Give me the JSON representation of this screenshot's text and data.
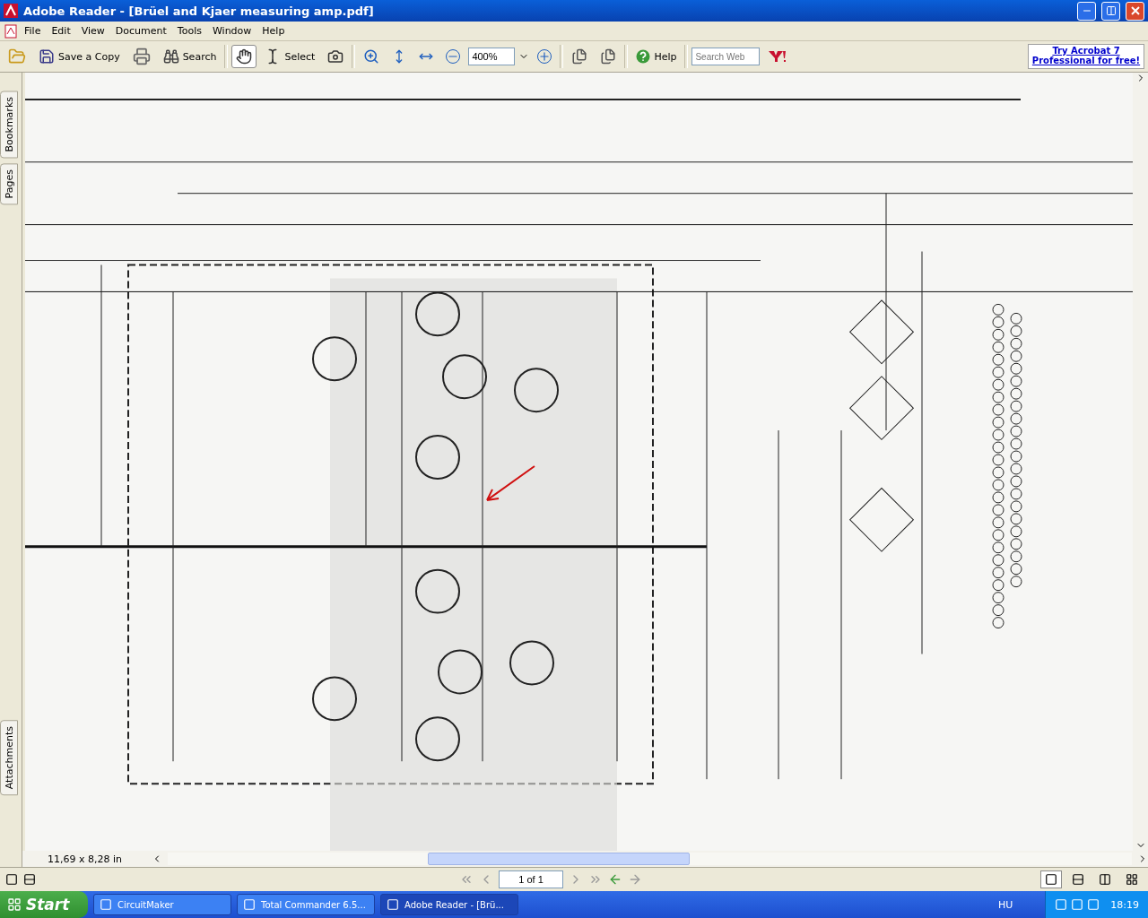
{
  "window": {
    "title": "Adobe Reader - [Brüel and Kjaer measuring amp.pdf]"
  },
  "menu": [
    "File",
    "Edit",
    "View",
    "Document",
    "Tools",
    "Window",
    "Help"
  ],
  "toolbar": [
    {
      "kind": "open",
      "selected": false
    },
    {
      "kind": "save",
      "label": "Save a Copy",
      "selected": false
    },
    {
      "kind": "print",
      "selected": false
    },
    {
      "kind": "search",
      "label": "Search",
      "selected": false
    },
    {
      "kind": "sep"
    },
    {
      "kind": "hand",
      "selected": true
    },
    {
      "kind": "select",
      "label": "Select",
      "selected": false
    },
    {
      "kind": "snapshot",
      "selected": false
    },
    {
      "kind": "sep"
    },
    {
      "kind": "zoomin",
      "selected": false
    },
    {
      "kind": "fitpage",
      "selected": false
    },
    {
      "kind": "fitwidth",
      "selected": false
    },
    {
      "kind": "zoomout",
      "selected": false
    },
    {
      "kind": "zoomfield",
      "label": "400%"
    },
    {
      "kind": "zoomplus",
      "selected": false
    },
    {
      "kind": "sep"
    },
    {
      "kind": "pages",
      "selected": false
    },
    {
      "kind": "rotate",
      "selected": false
    },
    {
      "kind": "sep"
    },
    {
      "kind": "help",
      "label": "Help",
      "selected": false
    },
    {
      "kind": "sep"
    },
    {
      "kind": "websearch",
      "placeholder": "Search Web"
    },
    {
      "kind": "yahoo",
      "selected": false
    }
  ],
  "promo": "Try Acrobat 7 Professional for free!",
  "side_tabs": [
    {
      "label": "Bookmarks"
    },
    {
      "label": "Pages"
    }
  ],
  "side_tabs_bottom": [
    {
      "label": "Attachments"
    }
  ],
  "page_size": "11,69 x 8,28 in",
  "page_field": "1 of 1",
  "layout_buttons": [
    {
      "selected": true
    },
    {
      "selected": false
    },
    {
      "selected": false
    },
    {
      "selected": false
    }
  ],
  "taskbar": {
    "start": "Start",
    "tasks": [
      {
        "label": "CircuitMaker",
        "selected": false
      },
      {
        "label": "Total Commander 6.5...",
        "selected": false
      },
      {
        "label": "Adobe Reader - [Brü...",
        "selected": true
      }
    ],
    "language": "HU",
    "clock": "18:19"
  }
}
